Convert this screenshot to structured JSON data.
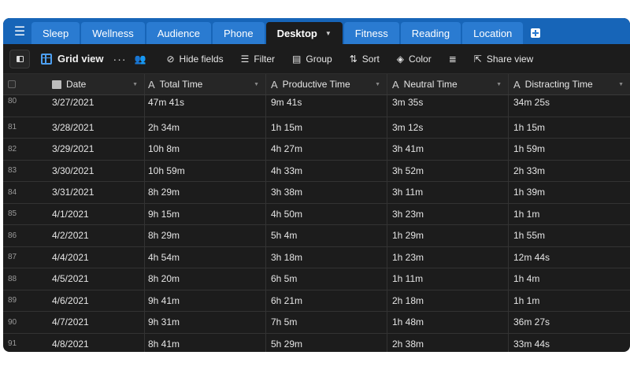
{
  "tabs": [
    {
      "label": "Sleep",
      "active": false
    },
    {
      "label": "Wellness",
      "active": false
    },
    {
      "label": "Audience",
      "active": false
    },
    {
      "label": "Phone",
      "active": false
    },
    {
      "label": "Desktop",
      "active": true
    },
    {
      "label": "Fitness",
      "active": false
    },
    {
      "label": "Reading",
      "active": false
    },
    {
      "label": "Location",
      "active": false
    }
  ],
  "toolbar": {
    "view_name": "Grid view",
    "more": "···",
    "hide_fields": "Hide fields",
    "filter": "Filter",
    "group": "Group",
    "sort": "Sort",
    "color": "Color",
    "share_view": "Share view"
  },
  "icons": {
    "menu": "hamburger-icon",
    "grid": "grid-icon",
    "hide": "eye-slash-icon",
    "filter": "filter-icon",
    "group": "group-icon",
    "sort": "sort-icon",
    "color": "paint-bucket-icon",
    "row_height": "row-height-icon",
    "share": "share-icon"
  },
  "columns": [
    {
      "label": "Date",
      "type": "date"
    },
    {
      "label": "Total Time",
      "type": "text"
    },
    {
      "label": "Productive Time",
      "type": "text"
    },
    {
      "label": "Neutral Time",
      "type": "text"
    },
    {
      "label": "Distracting Time",
      "type": "text"
    }
  ],
  "rows": [
    {
      "num": "80",
      "date": "3/27/2021",
      "total": "47m 41s",
      "productive": "9m 41s",
      "neutral": "3m 35s",
      "distracting": "34m 25s"
    },
    {
      "num": "81",
      "date": "3/28/2021",
      "total": "2h 34m",
      "productive": "1h 15m",
      "neutral": "3m 12s",
      "distracting": "1h 15m"
    },
    {
      "num": "82",
      "date": "3/29/2021",
      "total": "10h 8m",
      "productive": "4h 27m",
      "neutral": "3h 41m",
      "distracting": "1h 59m"
    },
    {
      "num": "83",
      "date": "3/30/2021",
      "total": "10h 59m",
      "productive": "4h 33m",
      "neutral": "3h 52m",
      "distracting": "2h 33m"
    },
    {
      "num": "84",
      "date": "3/31/2021",
      "total": "8h 29m",
      "productive": "3h 38m",
      "neutral": "3h 11m",
      "distracting": "1h 39m"
    },
    {
      "num": "85",
      "date": "4/1/2021",
      "total": "9h 15m",
      "productive": "4h 50m",
      "neutral": "3h 23m",
      "distracting": "1h 1m"
    },
    {
      "num": "86",
      "date": "4/2/2021",
      "total": "8h 29m",
      "productive": "5h 4m",
      "neutral": "1h 29m",
      "distracting": "1h 55m"
    },
    {
      "num": "87",
      "date": "4/4/2021",
      "total": "4h 54m",
      "productive": "3h 18m",
      "neutral": "1h 23m",
      "distracting": "12m 44s"
    },
    {
      "num": "88",
      "date": "4/5/2021",
      "total": "8h 20m",
      "productive": "6h 5m",
      "neutral": "1h 11m",
      "distracting": "1h 4m"
    },
    {
      "num": "89",
      "date": "4/6/2021",
      "total": "9h 41m",
      "productive": "6h 21m",
      "neutral": "2h 18m",
      "distracting": "1h 1m"
    },
    {
      "num": "90",
      "date": "4/7/2021",
      "total": "9h 31m",
      "productive": "7h 5m",
      "neutral": "1h 48m",
      "distracting": "36m 27s"
    },
    {
      "num": "91",
      "date": "4/8/2021",
      "total": "8h 41m",
      "productive": "5h 29m",
      "neutral": "2h 38m",
      "distracting": "33m 44s"
    }
  ]
}
